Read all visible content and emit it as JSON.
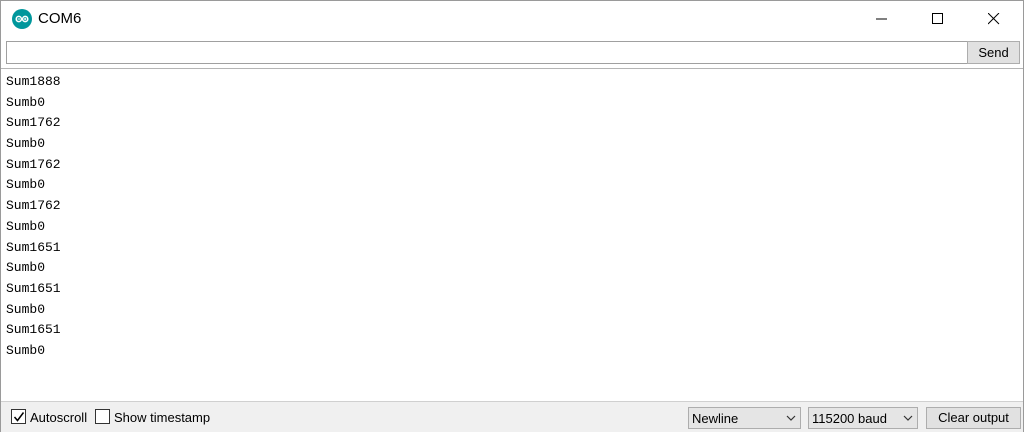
{
  "window": {
    "title": "COM6",
    "icon": "arduino-logo-icon",
    "controls": {
      "minimize_icon": "minimize-icon",
      "maximize_icon": "maximize-icon",
      "close_icon": "close-icon"
    }
  },
  "send_row": {
    "input_value": "",
    "send_label": "Send"
  },
  "output": {
    "lines": [
      "Sum1888",
      "Sumb0",
      "Sum1762",
      "Sumb0",
      "Sum1762",
      "Sumb0",
      "Sum1762",
      "Sumb0",
      "Sum1651",
      "Sumb0",
      "Sum1651",
      "Sumb0",
      "Sum1651",
      "Sumb0"
    ]
  },
  "bottom_bar": {
    "autoscroll": {
      "label": "Autoscroll",
      "checked": true
    },
    "show_timestamp": {
      "label": "Show timestamp",
      "checked": false
    },
    "line_ending": {
      "selected": "Newline"
    },
    "baud_rate": {
      "selected": "115200 baud"
    },
    "clear_label": "Clear output"
  },
  "colors": {
    "accent": "#00979c",
    "button_face": "#e1e1e1",
    "bar_background": "#f0f0f0"
  }
}
